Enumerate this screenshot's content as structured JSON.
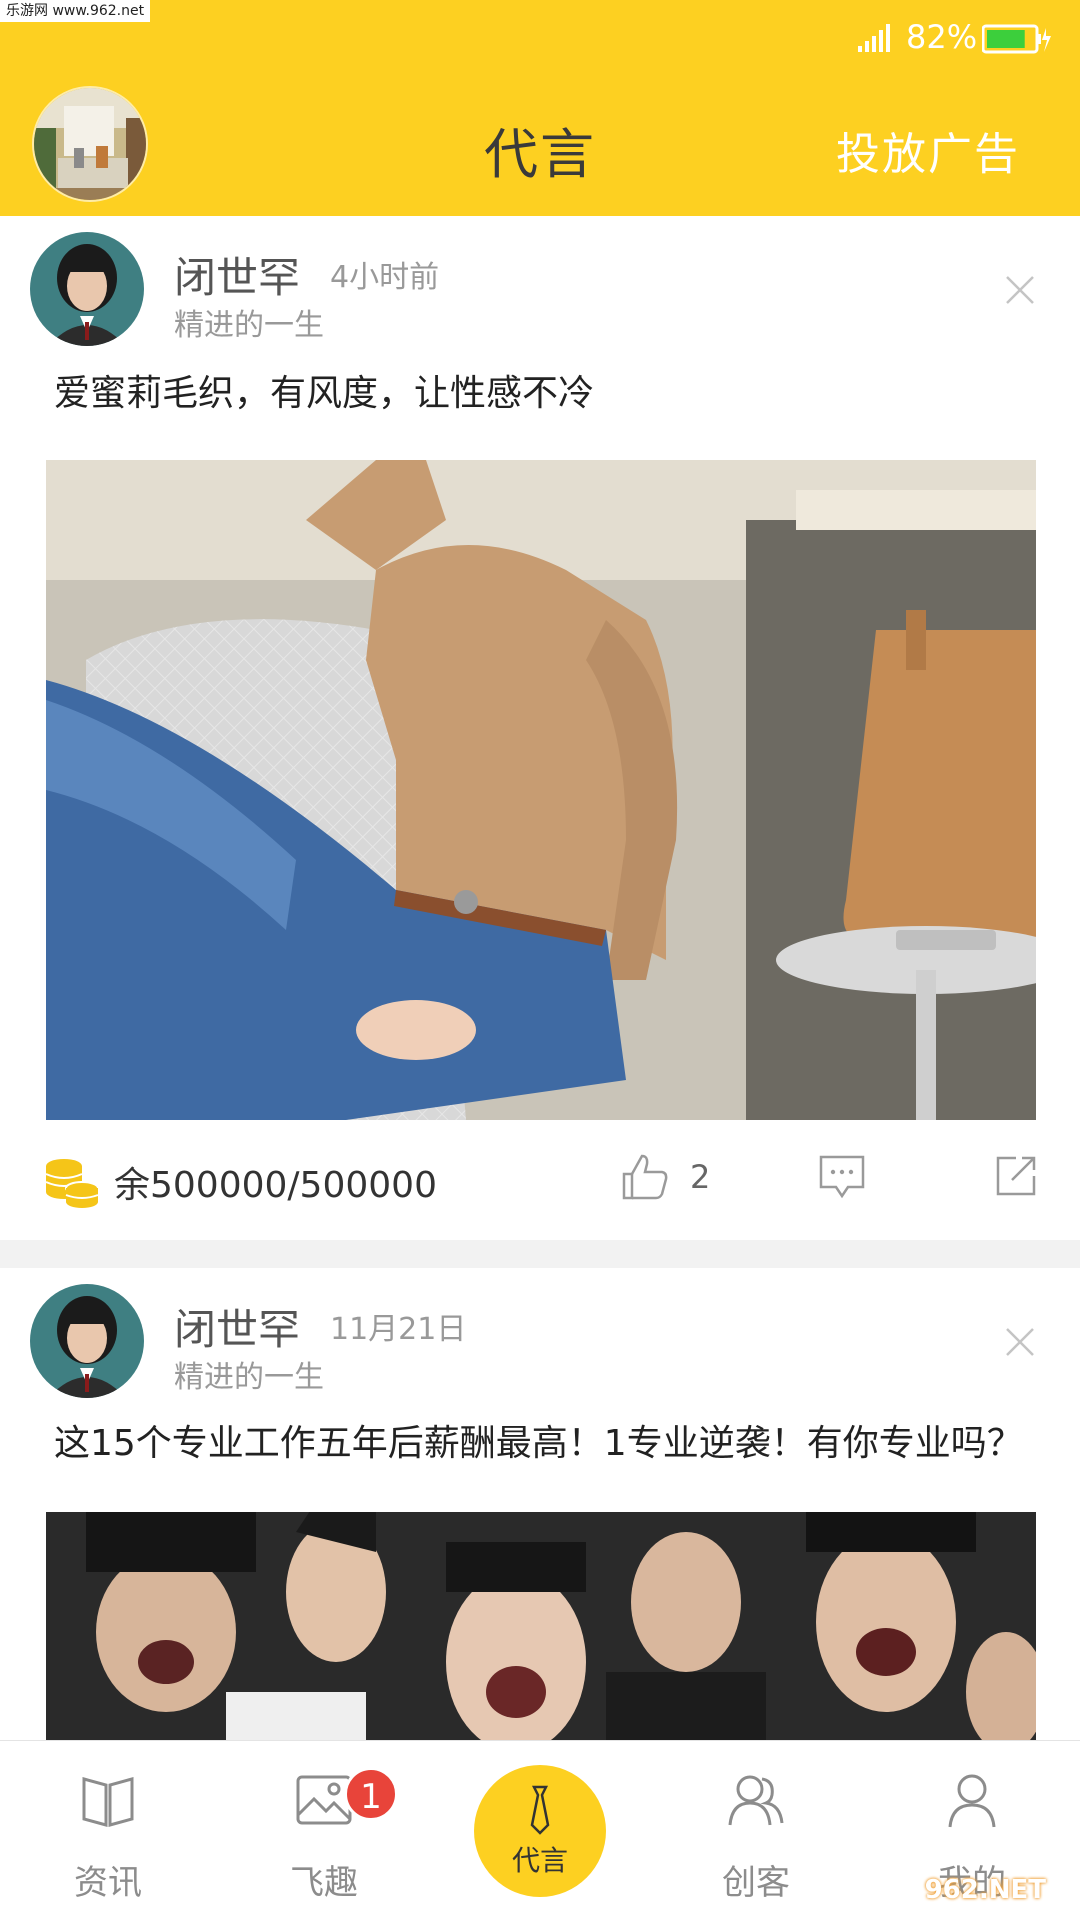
{
  "status_bar": {
    "watermark": "乐游网 www.962.net",
    "battery_percent": "82%",
    "battery_level": 0.82
  },
  "header": {
    "title": "代言",
    "action": "投放广告"
  },
  "feed": {
    "posts": [
      {
        "author": "闭世罕",
        "time": "4小时前",
        "author_sub": "精进的一生",
        "text": "爱蜜莉毛织，有风度，让性感不冷",
        "balance": "余500000/500000",
        "likes": "2"
      },
      {
        "author": "闭世罕",
        "time": "11月21日",
        "author_sub": "精进的一生",
        "text": "这15个专业工作五年后薪酬最高！1专业逆袭！有你专业吗？"
      }
    ]
  },
  "bottom_nav": {
    "items": [
      {
        "label": "资讯",
        "icon": "book-icon"
      },
      {
        "label": "飞趣",
        "icon": "image-icon",
        "badge": "1"
      },
      {
        "label": "代言",
        "icon": "tie-icon"
      },
      {
        "label": "创客",
        "icon": "users-icon"
      },
      {
        "label": "我的",
        "icon": "user-icon"
      }
    ],
    "watermark": "962.NET"
  },
  "colors": {
    "accent": "#FDD021",
    "badge": "#e8443a"
  }
}
